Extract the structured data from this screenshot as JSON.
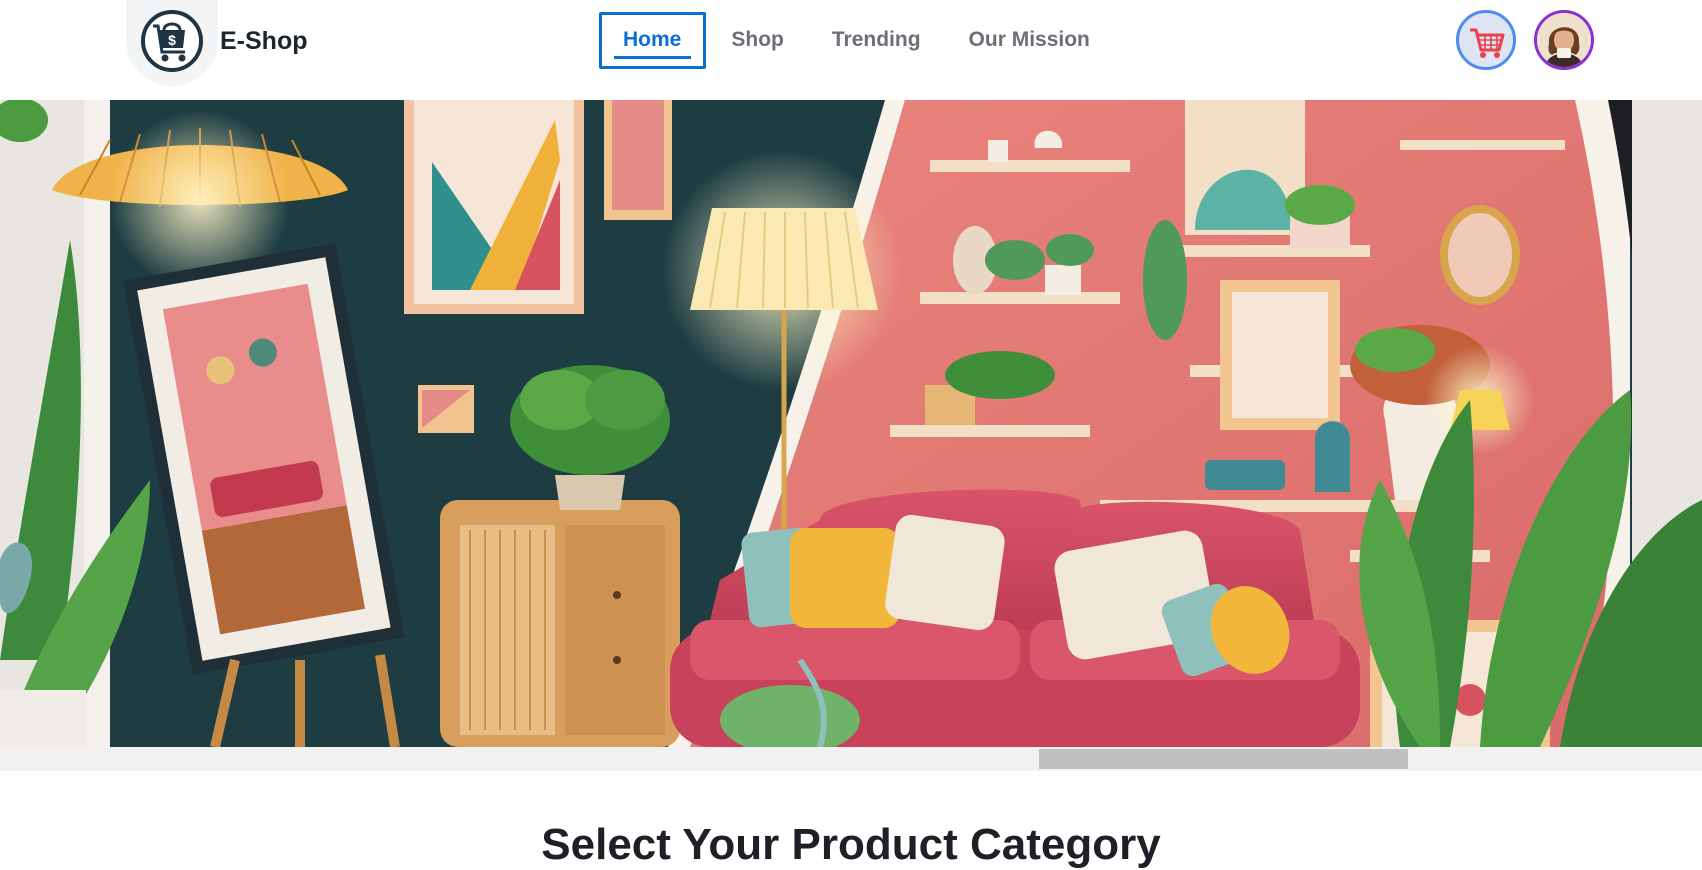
{
  "brand": {
    "name": "E-Shop",
    "logo_icon": "shopping-bag-dollar-icon"
  },
  "nav": {
    "items": [
      {
        "label": "Home",
        "active": true
      },
      {
        "label": "Shop",
        "active": false
      },
      {
        "label": "Trending",
        "active": false
      },
      {
        "label": "Our Mission",
        "active": false
      }
    ]
  },
  "actions": {
    "cart_icon": "cart-icon",
    "avatar_icon": "user-avatar"
  },
  "hero": {
    "image": "illustrated living room with pink sofa, lamps, shelves and plants",
    "scroll_position": 0.62
  },
  "section": {
    "title": "Select Your Product Category"
  },
  "colors": {
    "accent": "#0b6fd8",
    "cart_ring": "#4b8cef",
    "avatar_ring": "#8a2fd4",
    "cart_icon": "#e8434d",
    "logo_dark": "#203544"
  }
}
